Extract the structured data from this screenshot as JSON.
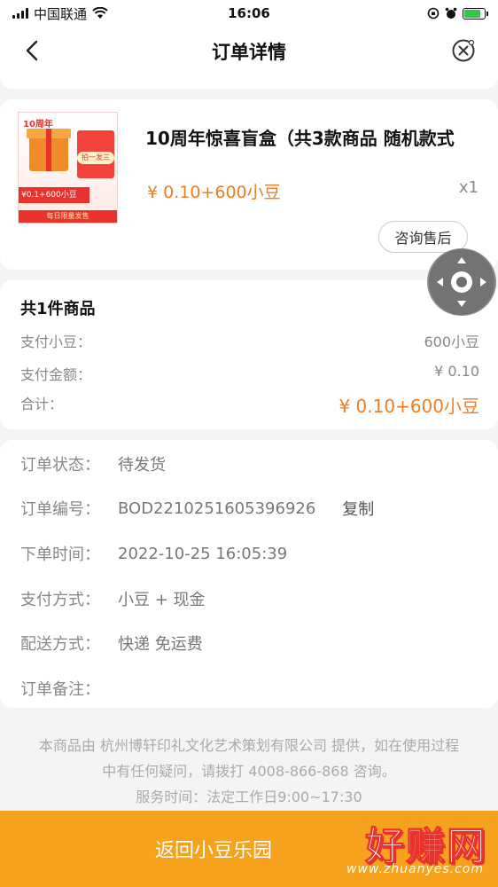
{
  "status_bar": {
    "carrier": "中国联通",
    "time": "16:06",
    "battery_level": 0.85
  },
  "nav": {
    "title": "订单详情"
  },
  "product": {
    "title": "10周年惊喜盲盒（共3款商品 随机款式",
    "price": "¥ 0.10+600小豆",
    "quantity": "x1",
    "service_button": "咨询售后",
    "thumb": {
      "logo": "10周年",
      "tag_button": "拍一发三",
      "price_strip": "¥0.1+600小豆",
      "bottom_strip": "每日限量发售"
    }
  },
  "summary": {
    "heading": "共1件商品",
    "rows": [
      {
        "label": "支付小豆：",
        "value": "600小豆"
      },
      {
        "label": "支付金额：",
        "value": "¥ 0.10"
      },
      {
        "label": "合计：",
        "value": "¥ 0.10+600小豆"
      }
    ]
  },
  "info": {
    "rows": [
      {
        "label": "订单状态：",
        "value": "待发货"
      },
      {
        "label": "订单编号：",
        "value": "BOD2210251605396926"
      },
      {
        "label": "下单时间：",
        "value": "2022-10-25 16:05:39"
      },
      {
        "label": "支付方式：",
        "value": "小豆 + 现金"
      },
      {
        "label": "配送方式：",
        "value": "快递 免运费"
      },
      {
        "label": "订单备注：",
        "value": ""
      }
    ],
    "copy_label": "复制"
  },
  "footer": {
    "line1": "本商品由 杭州博轩印礼文化艺术策划有限公司 提供，如在使用过程",
    "line2": "中有任何疑问，请拨打 4008-866-868 咨询。",
    "line3": "服务时间：法定工作日9:00~17:30"
  },
  "bottom_bar": {
    "label": "返回小豆乐园"
  },
  "watermark": {
    "text": "好赚网",
    "url": "www.zhuanyes.com"
  },
  "colors": {
    "accent": "#f07d24",
    "bottom_bar": "#f7a21c"
  }
}
